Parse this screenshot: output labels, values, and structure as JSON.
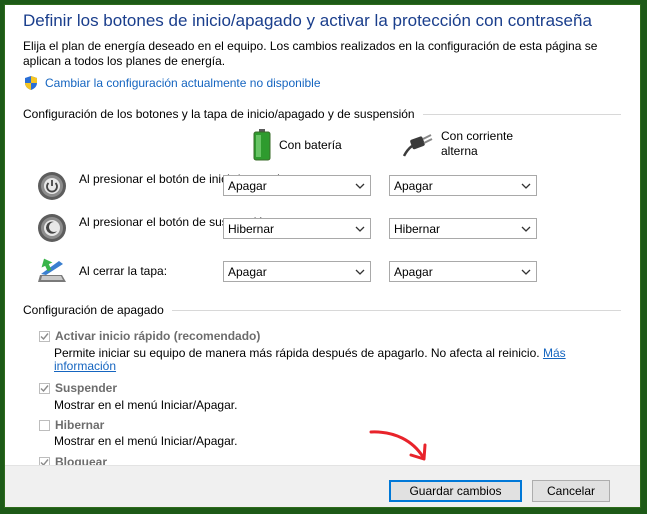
{
  "title": "Definir los botones de inicio/apagado y activar la protección con contraseña",
  "description": "Elija el plan de energía deseado en el equipo. Los cambios realizados en la configuración de esta página se aplican a todos los planes de energía.",
  "unavailable_link": "Cambiar la configuración actualmente no disponible",
  "buttons_section": {
    "heading": "Configuración de los botones y la tapa de inicio/apagado y de suspensión",
    "battery_label": "Con batería",
    "ac_label": "Con corriente alterna",
    "rows": [
      {
        "label": "Al presionar el botón de inicio/apagado:",
        "battery": "Apagar",
        "ac": "Apagar",
        "icon": "power-button-icon"
      },
      {
        "label": "Al presionar el botón de suspensión:",
        "battery": "Hibernar",
        "ac": "Hibernar",
        "icon": "sleep-button-icon"
      },
      {
        "label": "Al cerrar la tapa:",
        "battery": "Apagar",
        "ac": "Apagar",
        "icon": "laptop-lid-icon"
      }
    ]
  },
  "shutdown_section": {
    "heading": "Configuración de apagado",
    "items": [
      {
        "label": "Activar inicio rápido (recomendado)",
        "checked": true,
        "description": "Permite iniciar su equipo de manera más rápida después de apagarlo. No afecta al reinicio.",
        "more_link": "Más información"
      },
      {
        "label": "Suspender",
        "checked": true,
        "description": "Mostrar en el menú Iniciar/Apagar."
      },
      {
        "label": "Hibernar",
        "checked": false,
        "description": "Mostrar en el menú Iniciar/Apagar."
      },
      {
        "label": "Bloquear",
        "checked": true
      }
    ]
  },
  "footer": {
    "save_label": "Guardar cambios",
    "cancel_label": "Cancelar"
  },
  "colors": {
    "title": "#1a3e8c",
    "link": "#1565c0",
    "frame": "#1d5a17",
    "annotation_arrow": "#e8232b"
  }
}
